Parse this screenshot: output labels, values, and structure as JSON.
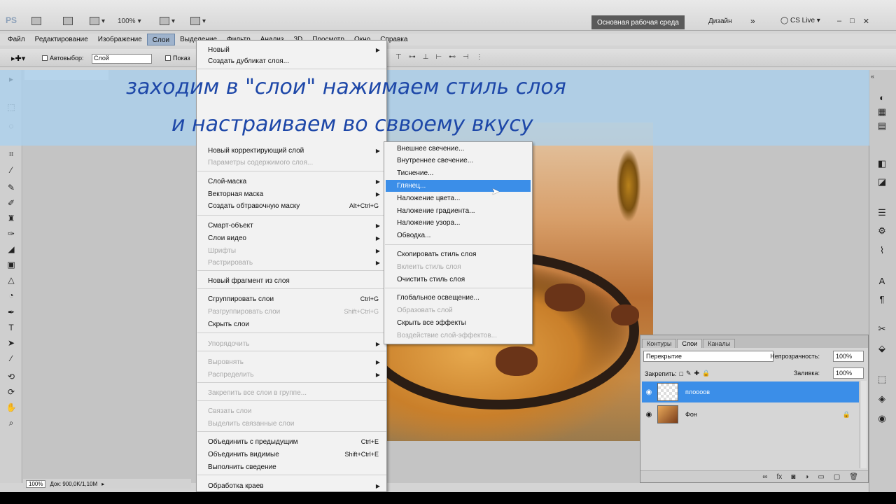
{
  "appbar": {
    "logo": "PS",
    "zoom": "100%",
    "workspace": "Основная рабочая среда",
    "design": "Дизайн",
    "more": "»",
    "cslive": "CS Live",
    "min": "–",
    "restore": "□",
    "close": "✕"
  },
  "menubar": [
    "Файл",
    "Редактирование",
    "Изображение",
    "Слои",
    "Выделение",
    "Фильтр",
    "Анализ",
    "3D",
    "Просмотр",
    "Окно",
    "Справка"
  ],
  "options": {
    "auto_select": "Автовыбор:",
    "auto_select_value": "Слой",
    "show": "Показ"
  },
  "caption": {
    "line1": "заходим в \"слои\" нажимаем стиль слоя",
    "line2": "и настраиваем во сввоему вкусу"
  },
  "layer_menu": {
    "items": [
      {
        "label": "Новый",
        "shortcut": "",
        "submenu": true,
        "disabled": false
      },
      {
        "label": "Создать дубликат слоя...",
        "shortcut": "",
        "submenu": false,
        "disabled": false
      },
      {
        "label": "Новый корректирующий слой",
        "shortcut": "",
        "submenu": true,
        "disabled": false
      },
      {
        "label": "Параметры содержимого слоя...",
        "shortcut": "",
        "submenu": false,
        "disabled": true
      },
      {
        "label": "Слой-маска",
        "shortcut": "",
        "submenu": true,
        "disabled": false
      },
      {
        "label": "Векторная маска",
        "shortcut": "",
        "submenu": true,
        "disabled": false
      },
      {
        "label": "Создать обтравочную маску",
        "shortcut": "Alt+Ctrl+G",
        "submenu": false,
        "disabled": false
      },
      {
        "label": "Смарт-объект",
        "shortcut": "",
        "submenu": true,
        "disabled": false
      },
      {
        "label": "Слои видео",
        "shortcut": "",
        "submenu": true,
        "disabled": false
      },
      {
        "label": "Шрифты",
        "shortcut": "",
        "submenu": true,
        "disabled": true
      },
      {
        "label": "Растрировать",
        "shortcut": "",
        "submenu": true,
        "disabled": true
      },
      {
        "label": "Новый фрагмент из слоя",
        "shortcut": "",
        "submenu": false,
        "disabled": false
      },
      {
        "label": "Сгруппировать слои",
        "shortcut": "Ctrl+G",
        "submenu": false,
        "disabled": false
      },
      {
        "label": "Разгруппировать слои",
        "shortcut": "Shift+Ctrl+G",
        "submenu": false,
        "disabled": true
      },
      {
        "label": "Скрыть слои",
        "shortcut": "",
        "submenu": false,
        "disabled": false
      },
      {
        "label": "Упорядочить",
        "shortcut": "",
        "submenu": true,
        "disabled": true
      },
      {
        "label": "Выровнять",
        "shortcut": "",
        "submenu": true,
        "disabled": true
      },
      {
        "label": "Распределить",
        "shortcut": "",
        "submenu": true,
        "disabled": true
      },
      {
        "label": "Закрепить все слои в группе...",
        "shortcut": "",
        "submenu": false,
        "disabled": true
      },
      {
        "label": "Связать слои",
        "shortcut": "",
        "submenu": false,
        "disabled": true
      },
      {
        "label": "Выделить связанные слои",
        "shortcut": "",
        "submenu": false,
        "disabled": true
      },
      {
        "label": "Объединить с предыдущим",
        "shortcut": "Ctrl+E",
        "submenu": false,
        "disabled": false
      },
      {
        "label": "Объединить видимые",
        "shortcut": "Shift+Ctrl+E",
        "submenu": false,
        "disabled": false
      },
      {
        "label": "Выполнить сведение",
        "shortcut": "",
        "submenu": false,
        "disabled": false
      },
      {
        "label": "Обработка краев",
        "shortcut": "",
        "submenu": true,
        "disabled": false
      }
    ]
  },
  "style_menu": {
    "items": [
      {
        "label": "Внешнее свечение...",
        "disabled": false,
        "highlight": false
      },
      {
        "label": "Внутреннее свечение...",
        "disabled": false,
        "highlight": false
      },
      {
        "label": "Тиснение...",
        "disabled": false,
        "highlight": false
      },
      {
        "label": "Глянец...",
        "disabled": false,
        "highlight": true
      },
      {
        "label": "Наложение цвета...",
        "disabled": false,
        "highlight": false
      },
      {
        "label": "Наложение градиента...",
        "disabled": false,
        "highlight": false
      },
      {
        "label": "Наложение узора...",
        "disabled": false,
        "highlight": false
      },
      {
        "label": "Обводка...",
        "disabled": false,
        "highlight": false
      },
      {
        "label": "Скопировать стиль слоя",
        "disabled": false,
        "highlight": false
      },
      {
        "label": "Вклеить стиль слоя",
        "disabled": true,
        "highlight": false
      },
      {
        "label": "Очистить стиль слоя",
        "disabled": false,
        "highlight": false
      },
      {
        "label": "Глобальное освещение...",
        "disabled": false,
        "highlight": false
      },
      {
        "label": "Образовать слой",
        "disabled": true,
        "highlight": false
      },
      {
        "label": "Скрыть все эффекты",
        "disabled": false,
        "highlight": false
      },
      {
        "label": "Воздействие слой-эффектов...",
        "disabled": true,
        "highlight": false
      }
    ]
  },
  "layers_panel": {
    "tabs": [
      "Контуры",
      "Слои",
      "Каналы"
    ],
    "blend_mode": "Перекрытие",
    "opacity_label": "Непрозрачность:",
    "opacity": "100%",
    "lock_label": "Закрепить:",
    "fill_label": "Заливка:",
    "fill": "100%",
    "layers": [
      {
        "name": "плоооов",
        "selected": true
      },
      {
        "name": "Фон",
        "selected": false
      }
    ]
  },
  "status": {
    "zoom": "100%",
    "doc": "Док: 900,0K/1,10M"
  },
  "colors": {
    "highlight": "#3b8ee8",
    "caption_text": "#1d47a8"
  }
}
